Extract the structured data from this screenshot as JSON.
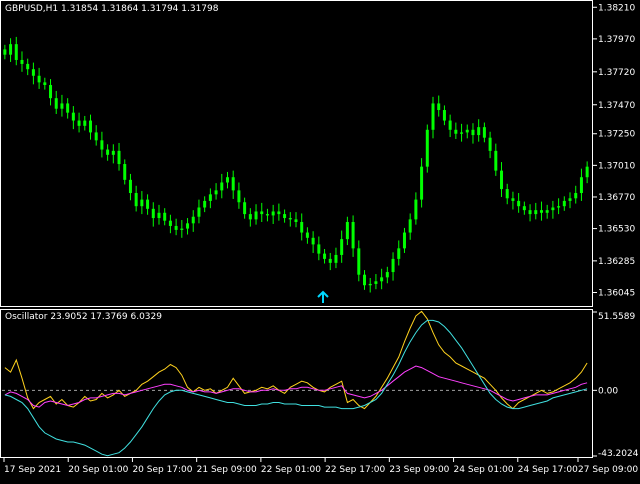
{
  "main_chart": {
    "header": "GBPUSD,H1  1.31854 1.31864 1.31794 1.31798",
    "price_axis": [
      "1.38210",
      "1.37970",
      "1.37720",
      "1.37470",
      "1.37250",
      "1.37010",
      "1.36770",
      "1.36530",
      "1.36285",
      "1.36045"
    ],
    "candle_color": "#00ff00",
    "signal_arrow_color": "#00d8ff"
  },
  "oscillator": {
    "header": "Oscillator 23.9052 17.3769 6.0329",
    "axis_top": "51.5589",
    "axis_zero": "0.00",
    "axis_bottom": "-43.2024",
    "series_colors": [
      "#ffd21e",
      "#ff40ff",
      "#40e0e0"
    ]
  },
  "time_axis": [
    "17 Sep 2021",
    "20 Sep 01:00",
    "20 Sep 17:00",
    "21 Sep 09:00",
    "22 Sep 01:00",
    "22 Sep 17:00",
    "23 Sep 09:00",
    "24 Sep 01:00",
    "24 Sep 17:00",
    "27 Sep 09:00"
  ],
  "chart_data": [
    {
      "type": "candlestick",
      "title": "GBPUSD,H1",
      "ylim": [
        1.3595,
        1.3825
      ],
      "x_ticks": [
        "17 Sep 2021",
        "20 Sep 01:00",
        "20 Sep 17:00",
        "21 Sep 09:00",
        "22 Sep 01:00",
        "22 Sep 17:00",
        "23 Sep 09:00",
        "24 Sep 01:00",
        "24 Sep 17:00",
        "27 Sep 09:00"
      ],
      "close": [
        1.3785,
        1.3793,
        1.3781,
        1.3778,
        1.3774,
        1.3769,
        1.3764,
        1.3762,
        1.3752,
        1.3744,
        1.3748,
        1.3741,
        1.3735,
        1.3731,
        1.3735,
        1.3726,
        1.372,
        1.3713,
        1.3709,
        1.3712,
        1.3702,
        1.369,
        1.368,
        1.367,
        1.3675,
        1.3668,
        1.3661,
        1.3665,
        1.3659,
        1.3655,
        1.3652,
        1.3653,
        1.3657,
        1.3662,
        1.3669,
        1.3674,
        1.3679,
        1.3682,
        1.3688,
        1.3692,
        1.3682,
        1.3673,
        1.3664,
        1.366,
        1.3666,
        1.3664,
        1.3663,
        1.3666,
        1.3664,
        1.3661,
        1.366,
        1.3658,
        1.365,
        1.3646,
        1.3641,
        1.3634,
        1.363,
        1.3627,
        1.3633,
        1.3645,
        1.3658,
        1.3638,
        1.3618,
        1.361,
        1.3611,
        1.3613,
        1.3616,
        1.362,
        1.363,
        1.3638,
        1.365,
        1.366,
        1.3675,
        1.37,
        1.3728,
        1.3748,
        1.3743,
        1.3735,
        1.3728,
        1.3725,
        1.3726,
        1.3728,
        1.3724,
        1.373,
        1.3722,
        1.3712,
        1.3697,
        1.3683,
        1.3676,
        1.3674,
        1.367,
        1.3667,
        1.3664,
        1.3667,
        1.3665,
        1.3667,
        1.3669,
        1.367,
        1.3674,
        1.3676,
        1.368,
        1.3692,
        1.37
      ]
    },
    {
      "type": "line",
      "title": "Oscillator",
      "ylim": [
        -43.2024,
        51.5589
      ],
      "series": [
        {
          "values": [
            15,
            12,
            20,
            8,
            -5,
            -12,
            -8,
            -6,
            -4,
            -9,
            -6,
            -10,
            -11,
            -8,
            -4,
            -7,
            -6,
            -2,
            -5,
            -3,
            0,
            -4,
            -2,
            0,
            4,
            6,
            9,
            12,
            14,
            17,
            15,
            10,
            2,
            -1,
            2,
            0,
            1,
            -2,
            0,
            2,
            8,
            3,
            -2,
            -1,
            0,
            2,
            1,
            3,
            0,
            -2,
            2,
            4,
            6,
            5,
            2,
            0,
            -1,
            2,
            4,
            6,
            -8,
            -6,
            -10,
            -12,
            -8,
            -4,
            2,
            8,
            15,
            22,
            32,
            41,
            49,
            52,
            47,
            38,
            30,
            25,
            22,
            18,
            16,
            14,
            12,
            10,
            8,
            4,
            0,
            -5,
            -9,
            -12,
            -8,
            -6,
            -4,
            -2,
            0,
            -2,
            -1,
            1,
            3,
            5,
            8,
            12,
            18
          ]
        },
        {
          "values": [
            -3,
            -1,
            -2,
            -4,
            -6,
            -10,
            -11,
            -8,
            -7,
            -8,
            -9,
            -10,
            -9,
            -8,
            -6,
            -5,
            -5,
            -4,
            -3,
            -2,
            -2,
            -3,
            -2,
            -1,
            0,
            1,
            2,
            3,
            4,
            4,
            3,
            2,
            0,
            -1,
            0,
            -1,
            -1,
            -2,
            -1,
            0,
            1,
            1,
            0,
            -1,
            -1,
            0,
            0,
            1,
            0,
            0,
            1,
            1,
            2,
            2,
            1,
            0,
            0,
            1,
            2,
            3,
            -2,
            -3,
            -4,
            -5,
            -4,
            -2,
            0,
            3,
            6,
            9,
            12,
            14,
            16,
            15,
            13,
            11,
            9,
            8,
            7,
            6,
            5,
            4,
            3,
            2,
            1,
            0,
            -2,
            -4,
            -6,
            -7,
            -6,
            -5,
            -4,
            -3,
            -3,
            -3,
            -2,
            -1,
            0,
            1,
            2,
            4,
            5
          ]
        },
        {
          "values": [
            -3,
            -4,
            -6,
            -8,
            -12,
            -18,
            -24,
            -28,
            -30,
            -32,
            -33,
            -34,
            -34,
            -35,
            -36,
            -38,
            -40,
            -42,
            -43,
            -42,
            -41,
            -38,
            -34,
            -29,
            -24,
            -18,
            -12,
            -7,
            -3,
            -1,
            0,
            0,
            -1,
            -2,
            -3,
            -4,
            -5,
            -6,
            -7,
            -8,
            -8,
            -9,
            -10,
            -10,
            -10,
            -9,
            -9,
            -8,
            -8,
            -9,
            -9,
            -9,
            -10,
            -10,
            -10,
            -10,
            -11,
            -11,
            -11,
            -12,
            -12,
            -12,
            -11,
            -10,
            -8,
            -6,
            -2,
            4,
            10,
            17,
            25,
            32,
            38,
            43,
            46,
            46,
            45,
            42,
            38,
            33,
            28,
            22,
            16,
            10,
            4,
            -2,
            -6,
            -9,
            -11,
            -12,
            -12,
            -11,
            -10,
            -9,
            -8,
            -7,
            -5,
            -4,
            -3,
            -2,
            -1,
            0,
            1
          ]
        }
      ],
      "zero_line": 0.0
    }
  ]
}
